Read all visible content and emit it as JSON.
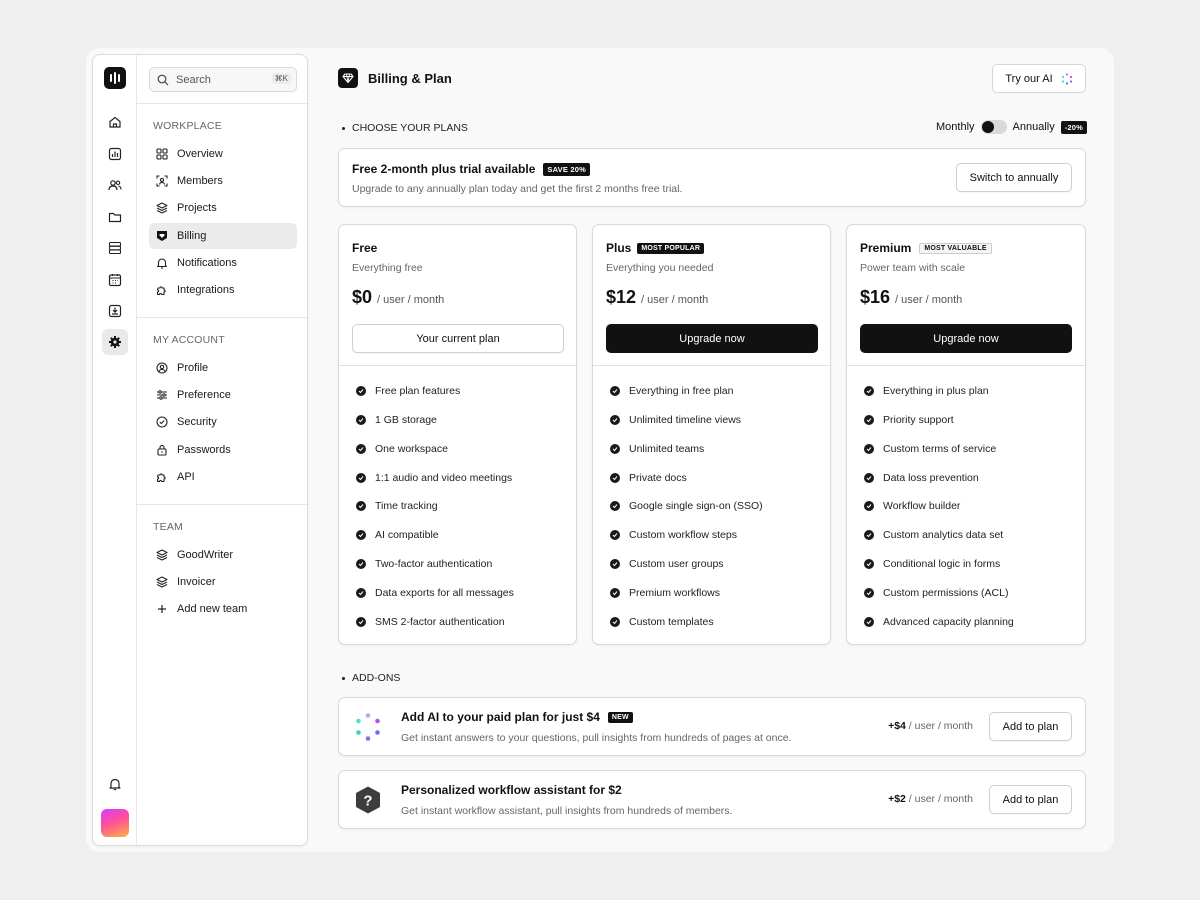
{
  "sidebar": {
    "search": {
      "label": "Search",
      "shortcut": "⌘K"
    },
    "sections": {
      "workplace": "WORKPLACE",
      "my_account": "MY ACCOUNT",
      "team": "TEAM"
    },
    "workplace_items": [
      "Overview",
      "Members",
      "Projects",
      "Billing",
      "Notifications",
      "Integrations"
    ],
    "account_items": [
      "Profile",
      "Preference",
      "Security",
      "Passwords",
      "API"
    ],
    "team_items": [
      "GoodWriter",
      "Invoicer",
      "Add new team"
    ],
    "active_item": "Billing"
  },
  "header": {
    "title": "Billing & Plan",
    "try_ai": "Try our AI"
  },
  "plans_section": {
    "title": "CHOOSE YOUR PLANS",
    "toggle": {
      "monthly": "Monthly",
      "annually": "Annually",
      "discount": "-20%",
      "state": "Monthly"
    }
  },
  "trial": {
    "title": "Free 2-month plus trial available",
    "badge": "SAVE 20%",
    "subtitle": "Upgrade to any annually plan today and get the first 2 months free trial.",
    "button": "Switch to annually"
  },
  "plans": [
    {
      "name": "Free",
      "badge": "",
      "desc": "Everything free",
      "price": "$0",
      "per": "/ user / month",
      "button": "Your current plan",
      "features": [
        "Free plan features",
        "1 GB storage",
        "One workspace",
        "1:1 audio and video meetings",
        "Time tracking",
        "AI compatible",
        "Two-factor authentication",
        "Data exports for all messages",
        "SMS 2-factor authentication"
      ]
    },
    {
      "name": "Plus",
      "badge": "MOST POPULAR",
      "desc": "Everything you needed",
      "price": "$12",
      "per": "/ user / month",
      "button": "Upgrade now",
      "features": [
        "Everything in free plan",
        "Unlimited timeline views",
        "Unlimited teams",
        "Private docs",
        "Google single sign-on (SSO)",
        "Custom workflow steps",
        "Custom user groups",
        "Premium workflows",
        "Custom templates"
      ]
    },
    {
      "name": "Premium",
      "badge": "MOST VALUABLE",
      "desc": "Power team with scale",
      "price": "$16",
      "per": "/ user / month",
      "button": "Upgrade now",
      "features": [
        "Everything in plus plan",
        "Priority support",
        "Custom terms of service",
        "Data loss prevention",
        "Workflow builder",
        "Custom analytics data set",
        "Conditional logic in forms",
        "Custom permissions (ACL)",
        "Advanced capacity planning"
      ]
    }
  ],
  "addons_section": {
    "title": "ADD-ONS"
  },
  "addons": [
    {
      "title": "Add AI to your paid plan for just $4",
      "badge": "NEW",
      "subtitle": "Get instant answers to your questions, pull insights from hundreds of pages at once.",
      "price": "+$4",
      "per": "/ user / month",
      "button": "Add to plan",
      "icon": "ai-dots-icon"
    },
    {
      "title": "Personalized workflow assistant for $2",
      "badge": "",
      "subtitle": "Get instant workflow assistant, pull insights from hundreds of members.",
      "price": "+$2",
      "per": "/ user / month",
      "button": "Add to plan",
      "icon": "question-hexagon-icon"
    }
  ]
}
